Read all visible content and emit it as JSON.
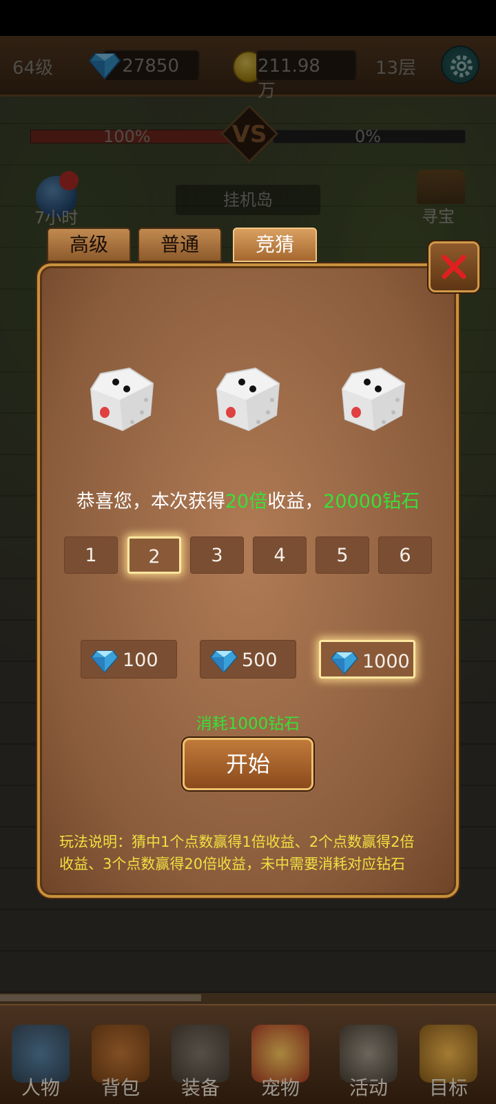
{
  "topbar": {
    "level": "64级",
    "diamonds": "27850",
    "gold": "211.98万",
    "floor": "13层"
  },
  "battle": {
    "left_percent": "100%",
    "right_percent": "0%",
    "idle_hours": "7小时",
    "location": "挂机岛",
    "treasure": "寻宝"
  },
  "tabs": [
    {
      "label": "高级"
    },
    {
      "label": "普通"
    },
    {
      "label": "竞猜"
    }
  ],
  "panel": {
    "result_prefix": "恭喜您，本次获得",
    "result_multiplier": "20倍",
    "result_middle": "收益，",
    "result_reward": "20000钻石",
    "numbers": [
      "1",
      "2",
      "3",
      "4",
      "5",
      "6"
    ],
    "selected_number": "2",
    "bets": [
      "100",
      "500",
      "1000"
    ],
    "selected_bet": "1000",
    "cost_text": "消耗1000钻石",
    "start_label": "开始",
    "rules_line1": "玩法说明：猜中1个点数赢得1倍收益、2个点数赢得2倍",
    "rules_line2": "收益、3个点数赢得20倍收益，未中需要消耗对应钻石",
    "dice": [
      2,
      2,
      2
    ]
  },
  "bottom_nav": [
    {
      "label": "人物",
      "icon": "character-icon"
    },
    {
      "label": "背包",
      "icon": "backpack-icon"
    },
    {
      "label": "装备",
      "icon": "equipment-icon"
    },
    {
      "label": "宠物",
      "icon": "pet-icon"
    },
    {
      "label": "活动",
      "icon": "activity-icon"
    },
    {
      "label": "目标",
      "icon": "target-icon"
    }
  ],
  "colors": {
    "highlight_green": "#38e038",
    "rules_yellow": "#f0e040",
    "close_red": "#e02020"
  }
}
